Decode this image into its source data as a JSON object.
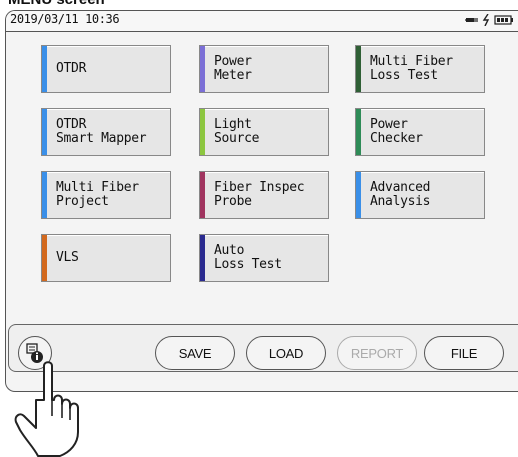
{
  "caption": "MENU screen",
  "status_bar": {
    "datetime": "2019/03/11 10:36",
    "icons": [
      "ac-power-icon",
      "charging-icon",
      "battery-icon"
    ]
  },
  "menu_tiles": [
    {
      "name": "otdr",
      "label": "OTDR",
      "color": "#3a8fe8"
    },
    {
      "name": "power-meter",
      "label": "Power\nMeter",
      "color": "#7b6fd6"
    },
    {
      "name": "multi-fiber-loss-test",
      "label": "Multi Fiber\nLoss Test",
      "color": "#2f5f35"
    },
    {
      "name": "otdr-smart-mapper",
      "label": "OTDR\nSmart Mapper",
      "color": "#3a8fe8"
    },
    {
      "name": "light-source",
      "label": "Light\nSource",
      "color": "#8cc63f"
    },
    {
      "name": "power-checker",
      "label": "Power\nChecker",
      "color": "#2e8b57"
    },
    {
      "name": "multi-fiber-project",
      "label": "Multi Fiber\nProject",
      "color": "#3a8fe8"
    },
    {
      "name": "fiber-inspec-probe",
      "label": "Fiber Inspec\nProbe",
      "color": "#a0345f"
    },
    {
      "name": "advanced-analysis",
      "label": "Advanced\nAnalysis",
      "color": "#3a8fe8"
    },
    {
      "name": "vls",
      "label": "VLS",
      "color": "#d2691e"
    },
    {
      "name": "auto-loss-test",
      "label": "Auto\nLoss Test",
      "color": "#2a2a8f"
    }
  ],
  "bottom_bar": {
    "system_icon": "system-info-icon",
    "buttons": [
      {
        "name": "save",
        "label": "SAVE",
        "enabled": true
      },
      {
        "name": "load",
        "label": "LOAD",
        "enabled": true
      },
      {
        "name": "report",
        "label": "REPORT",
        "enabled": false
      },
      {
        "name": "file",
        "label": "FILE",
        "enabled": true
      }
    ]
  }
}
